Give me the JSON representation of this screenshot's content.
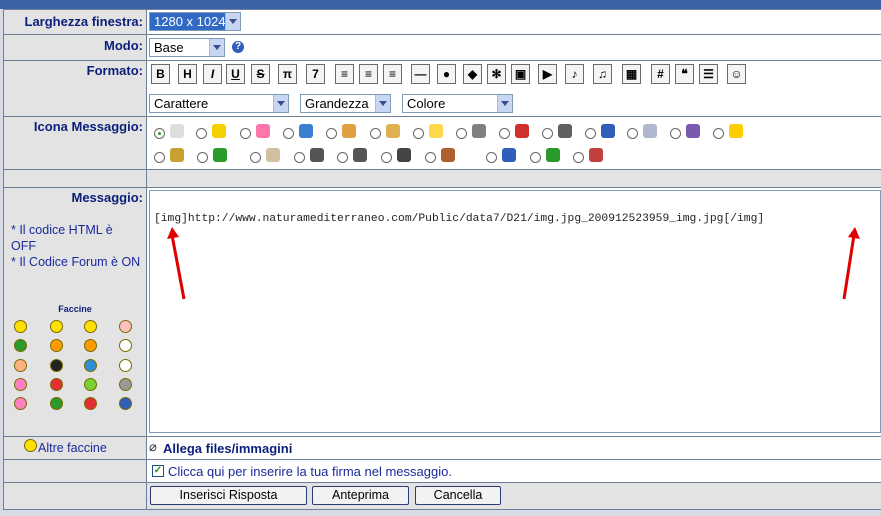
{
  "labels": {
    "width": "Larghezza finestra:",
    "mode": "Modo:",
    "format": "Formato:",
    "icon": "Icona Messaggio:",
    "message": "Messaggio:",
    "html_note": "* Il codice HTML è OFF",
    "forum_note": "* Il Codice Forum è ON",
    "faccine": "Faccine",
    "more_smileys": "Altre faccine"
  },
  "selects": {
    "window_width": "1280 x 1024",
    "mode": "Base",
    "font": "Carattere",
    "size": "Grandezza",
    "color": "Colore"
  },
  "toolbar": [
    {
      "name": "bold-button",
      "text": "B"
    },
    {
      "name": "highlight-button",
      "text": "H"
    },
    {
      "name": "italic-button",
      "text": "I"
    },
    {
      "name": "underline-button",
      "text": "U"
    },
    {
      "name": "strike-button",
      "text": "S"
    },
    {
      "name": "pi-button",
      "text": "π"
    },
    {
      "name": "italic-box-button",
      "text": "7"
    },
    {
      "name": "align-left-button",
      "text": "≡"
    },
    {
      "name": "align-center-button",
      "text": "≡"
    },
    {
      "name": "align-right-button",
      "text": "≡"
    },
    {
      "name": "hr-button",
      "text": "—"
    },
    {
      "name": "web-button",
      "text": "●"
    },
    {
      "name": "image-button",
      "text": "◆"
    },
    {
      "name": "film-button",
      "text": "✻"
    },
    {
      "name": "picture-button",
      "text": "▣"
    },
    {
      "name": "youtube-button",
      "text": "▶"
    },
    {
      "name": "wmv-button",
      "text": "♪"
    },
    {
      "name": "mp3-button",
      "text": "♫"
    },
    {
      "name": "table-button",
      "text": "▦"
    },
    {
      "name": "hash-button",
      "text": "#"
    },
    {
      "name": "quote-button",
      "text": "❝"
    },
    {
      "name": "list-button",
      "text": "☰"
    },
    {
      "name": "smiley-button",
      "text": "☺"
    }
  ],
  "message_text": "[img]http://www.naturamediterraneo.com/Public/data7/D21/img.jpg_200912523959_img.jpg[/img]",
  "attach_label": "Allega files/immagini",
  "signature_label": "Clicca qui per inserire la tua firma nel messaggio.",
  "signature_checked": true,
  "buttons": {
    "submit": "Inserisci Risposta",
    "preview": "Anteprima",
    "cancel": "Cancella"
  },
  "colors": {
    "label_text": "#0b1f7a",
    "label_bg": "#e3e3e3",
    "border": "#6f7f9a",
    "arrow": "#e00000"
  }
}
